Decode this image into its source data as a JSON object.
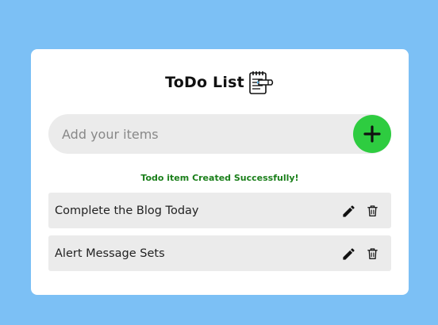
{
  "header": {
    "title": "ToDo List",
    "icon": "notepad-icon"
  },
  "input": {
    "placeholder": "Add your items",
    "value": ""
  },
  "add_button": {
    "icon": "plus-icon",
    "color": "#2ecc40"
  },
  "status_message": "Todo item Created Successfully!",
  "todos": [
    {
      "text": "Complete the Blog Today"
    },
    {
      "text": "Alert Message Sets"
    }
  ],
  "colors": {
    "background": "#7cc0f5",
    "card": "#ffffff",
    "item_bg": "#ebebeb",
    "success_text": "#1a7f1a"
  }
}
